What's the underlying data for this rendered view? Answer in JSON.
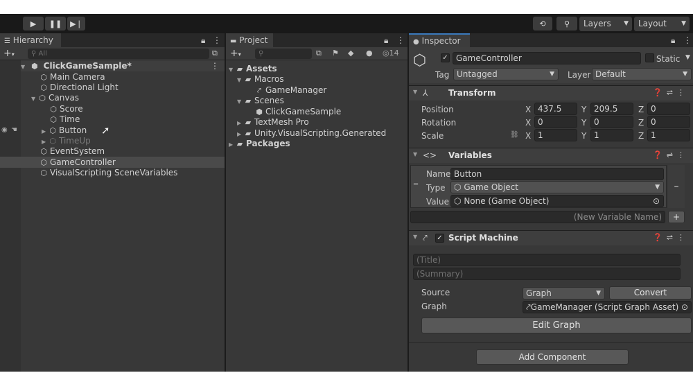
{
  "toolbar": {
    "play_icon": "play-icon",
    "pause_icon": "pause-icon",
    "step_icon": "step-icon",
    "history_icon": "history-icon",
    "search_icon": "search-icon",
    "layers_label": "Layers",
    "layout_label": "Layout"
  },
  "hierarchy": {
    "tab_label": "Hierarchy",
    "search_placeholder": "All",
    "items": [
      {
        "label": "ClickGameSample*"
      },
      {
        "label": "Main Camera"
      },
      {
        "label": "Directional Light"
      },
      {
        "label": "Canvas"
      },
      {
        "label": "Score"
      },
      {
        "label": "Time"
      },
      {
        "label": "Button"
      },
      {
        "label": "TimeUp"
      },
      {
        "label": "EventSystem"
      },
      {
        "label": "GameController"
      },
      {
        "label": "VisualScripting SceneVariables"
      }
    ]
  },
  "project": {
    "tab_label": "Project",
    "count": "14",
    "items": [
      {
        "label": "Assets"
      },
      {
        "label": "Macros"
      },
      {
        "label": "GameManager"
      },
      {
        "label": "Scenes"
      },
      {
        "label": "ClickGameSample"
      },
      {
        "label": "TextMesh Pro"
      },
      {
        "label": "Unity.VisualScripting.Generated"
      },
      {
        "label": "Packages"
      }
    ]
  },
  "inspector": {
    "tab_label": "Inspector",
    "object_name": "GameController",
    "static_label": "Static",
    "tag_label": "Tag",
    "tag_value": "Untagged",
    "layer_label": "Layer",
    "layer_value": "Default",
    "transform": {
      "title": "Transform",
      "position_label": "Position",
      "rotation_label": "Rotation",
      "scale_label": "Scale",
      "axis_x": "X",
      "axis_y": "Y",
      "axis_z": "Z",
      "position": {
        "x": "437.5",
        "y": "209.5",
        "z": "0"
      },
      "rotation": {
        "x": "0",
        "y": "0",
        "z": "0"
      },
      "scale": {
        "x": "1",
        "y": "1",
        "z": "1"
      }
    },
    "variables": {
      "title": "Variables",
      "name_label": "Name",
      "name_value": "Button",
      "type_label": "Type",
      "type_value": "Game Object",
      "value_label": "Value",
      "value_value": "None (Game Object)",
      "minus_label": "–",
      "new_variable_placeholder": "(New Variable Name)",
      "plus_label": "+"
    },
    "script_machine": {
      "title": "Script Machine",
      "title_placeholder": "(Title)",
      "summary_placeholder": "(Summary)",
      "source_label": "Source",
      "source_value": "Graph",
      "convert_label": "Convert",
      "graph_label": "Graph",
      "graph_value": "GameManager (Script Graph Asset)",
      "edit_graph_label": "Edit Graph"
    },
    "add_component_label": "Add Component"
  }
}
